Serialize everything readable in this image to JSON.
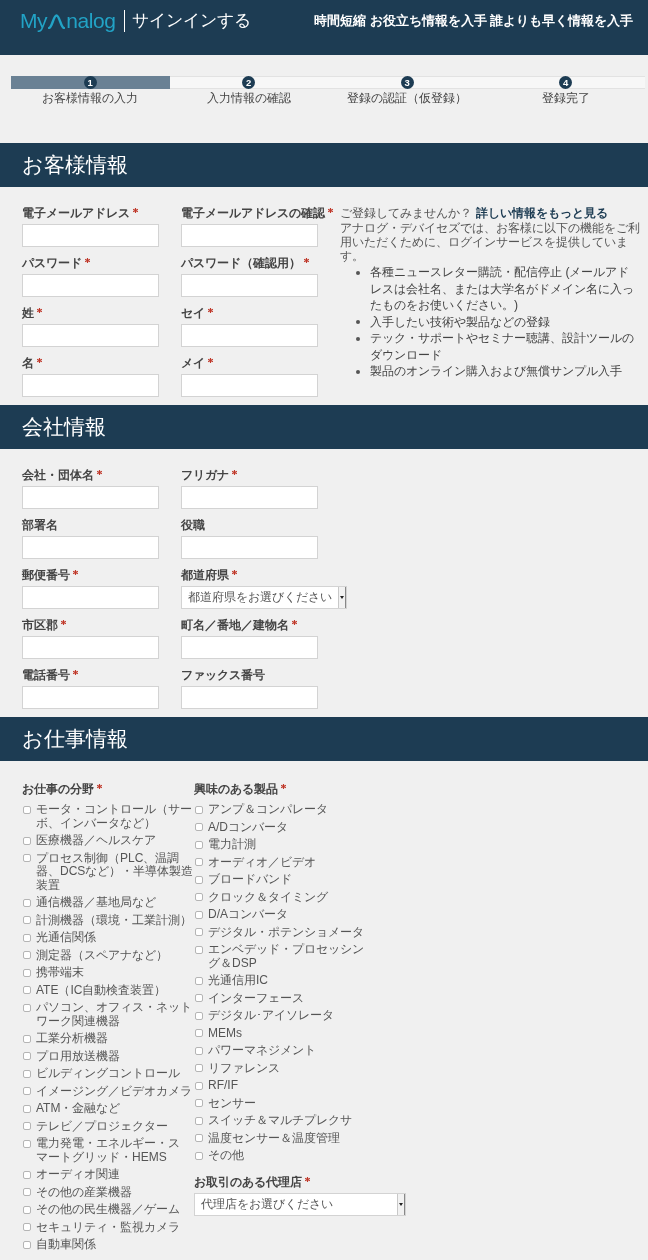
{
  "header": {
    "logo": {
      "before": "My",
      "after": "nalog"
    },
    "title": "サインインする",
    "tagline": "時間短縮 お役立ち情報を入手 誰よりも早く情報を入手"
  },
  "steps": [
    {
      "number": "1",
      "label": "お客様情報の入力",
      "selected": true
    },
    {
      "number": "2",
      "label": "入力情報の確認",
      "selected": false
    },
    {
      "number": "3",
      "label": "登録の認証（仮登録）",
      "selected": false
    },
    {
      "number": "4",
      "label": "登録完了",
      "selected": false
    }
  ],
  "sections": [
    {
      "kind": "form",
      "title": "お客様情報",
      "fields": [
        {
          "kind": "text",
          "label": "電子メールアドレス",
          "required": true
        },
        {
          "kind": "text",
          "label": "電子メールアドレスの確認",
          "required": true
        },
        {
          "kind": "text",
          "label": "パスワード",
          "required": true
        },
        {
          "kind": "text",
          "label": "パスワード（確認用）",
          "required": true
        },
        {
          "kind": "text",
          "label": "姓",
          "required": true
        },
        {
          "kind": "text",
          "label": "セイ",
          "required": true
        },
        {
          "kind": "text",
          "label": "名",
          "required": true
        },
        {
          "kind": "text",
          "label": "メイ",
          "required": true
        }
      ],
      "promo": {
        "prompt": "ご登録してみませんか？",
        "link": "詳しい情報をもっと見る",
        "description": "アナログ・デバイセズでは、お客様に以下の機能をご利用いただくために、ログインサービスを提供しています。",
        "benefits": [
          "各種ニュースレター購読・配信停止 (メールアドレスは会社名、または大学名がドメイン名に入ったものをお使いください。)",
          "入手したい技術や製品などの登録",
          "テック・サポートやセミナー聴講、設計ツールのダウンロード",
          "製品のオンライン購入および無償サンプル入手"
        ]
      }
    },
    {
      "kind": "form",
      "title": "会社情報",
      "fields": [
        {
          "kind": "text",
          "label": "会社・団体名",
          "required": true
        },
        {
          "kind": "text",
          "label": "フリガナ",
          "required": true
        },
        {
          "kind": "text",
          "label": "部署名",
          "required": false
        },
        {
          "kind": "text",
          "label": "役職",
          "required": false
        },
        {
          "kind": "text",
          "label": "郵便番号",
          "required": true
        },
        {
          "kind": "select",
          "label": "都道府県",
          "required": true,
          "value": "都道府県をお選びください"
        },
        {
          "kind": "text",
          "label": "市区郡",
          "required": true
        },
        {
          "kind": "text",
          "label": "町名／番地／建物名",
          "required": true
        },
        {
          "kind": "text",
          "label": "電話番号",
          "required": true
        },
        {
          "kind": "text",
          "label": "ファックス番号",
          "required": false
        }
      ]
    },
    {
      "kind": "checklists",
      "title": "お仕事情報",
      "columns": [
        {
          "label": "お仕事の分野",
          "required": true,
          "options": [
            {
              "label": "モータ・コントロール（サーボ、インバータなど）",
              "checked": false
            },
            {
              "label": "医療機器／ヘルスケア",
              "checked": false
            },
            {
              "label": "プロセス制御（PLC、温調器、DCSなど）・半導体製造装置",
              "checked": false
            },
            {
              "label": "通信機器／基地局など",
              "checked": false
            },
            {
              "label": "計測機器（環境・工業計測）",
              "checked": false
            },
            {
              "label": "光通信関係",
              "checked": false
            },
            {
              "label": "測定器（スペアナなど）",
              "checked": false
            },
            {
              "label": "携帯端末",
              "checked": false
            },
            {
              "label": "ATE（IC自動検査装置）",
              "checked": false
            },
            {
              "label": "パソコン、オフィス・ネットワーク関連機器",
              "checked": false
            },
            {
              "label": "工業分析機器",
              "checked": false
            },
            {
              "label": "プロ用放送機器",
              "checked": false
            },
            {
              "label": "ビルディングコントロール",
              "checked": false
            },
            {
              "label": "イメージング／ビデオカメラ",
              "checked": false
            },
            {
              "label": "ATM・金融など",
              "checked": false
            },
            {
              "label": "テレビ／プロジェクター",
              "checked": false
            },
            {
              "label": "電力発電・エネルギー・スマートグリッド・HEMS",
              "checked": false
            },
            {
              "label": "オーディオ関連",
              "checked": false
            },
            {
              "label": "その他の産業機器",
              "checked": false
            },
            {
              "label": "その他の民生機器／ゲーム",
              "checked": false
            },
            {
              "label": "セキュリティ・監視カメラ",
              "checked": false
            },
            {
              "label": "自動車関係",
              "checked": false
            }
          ]
        },
        {
          "label": "興味のある製品",
          "required": true,
          "options": [
            {
              "label": "アンプ＆コンパレータ",
              "checked": false
            },
            {
              "label": "A/Dコンバータ",
              "checked": false
            },
            {
              "label": "電力計測",
              "checked": false
            },
            {
              "label": "オーディオ／ビデオ",
              "checked": false
            },
            {
              "label": "ブロードバンド",
              "checked": false
            },
            {
              "label": "クロック＆タイミング",
              "checked": false
            },
            {
              "label": "D/Aコンバータ",
              "checked": false
            },
            {
              "label": "デジタル・ポテンショメータ",
              "checked": false
            },
            {
              "label": "エンベデッド・プロセッシング＆DSP",
              "checked": false
            },
            {
              "label": "光通信用IC",
              "checked": false
            },
            {
              "label": "インターフェース",
              "checked": false
            },
            {
              "label": "デジタル･アイソレータ",
              "checked": false
            },
            {
              "label": "MEMs",
              "checked": false
            },
            {
              "label": "パワーマネジメント",
              "checked": false
            },
            {
              "label": "リファレンス",
              "checked": false
            },
            {
              "label": "RF/IF",
              "checked": false
            },
            {
              "label": "センサー",
              "checked": false
            },
            {
              "label": "スイッチ＆マルチプレクサ",
              "checked": false
            },
            {
              "label": "温度センサー＆温度管理",
              "checked": false
            },
            {
              "label": "その他",
              "checked": false
            }
          ],
          "dealer": {
            "label": "お取引のある代理店",
            "required": true,
            "value": "代理店をお選びください"
          }
        }
      ]
    }
  ]
}
